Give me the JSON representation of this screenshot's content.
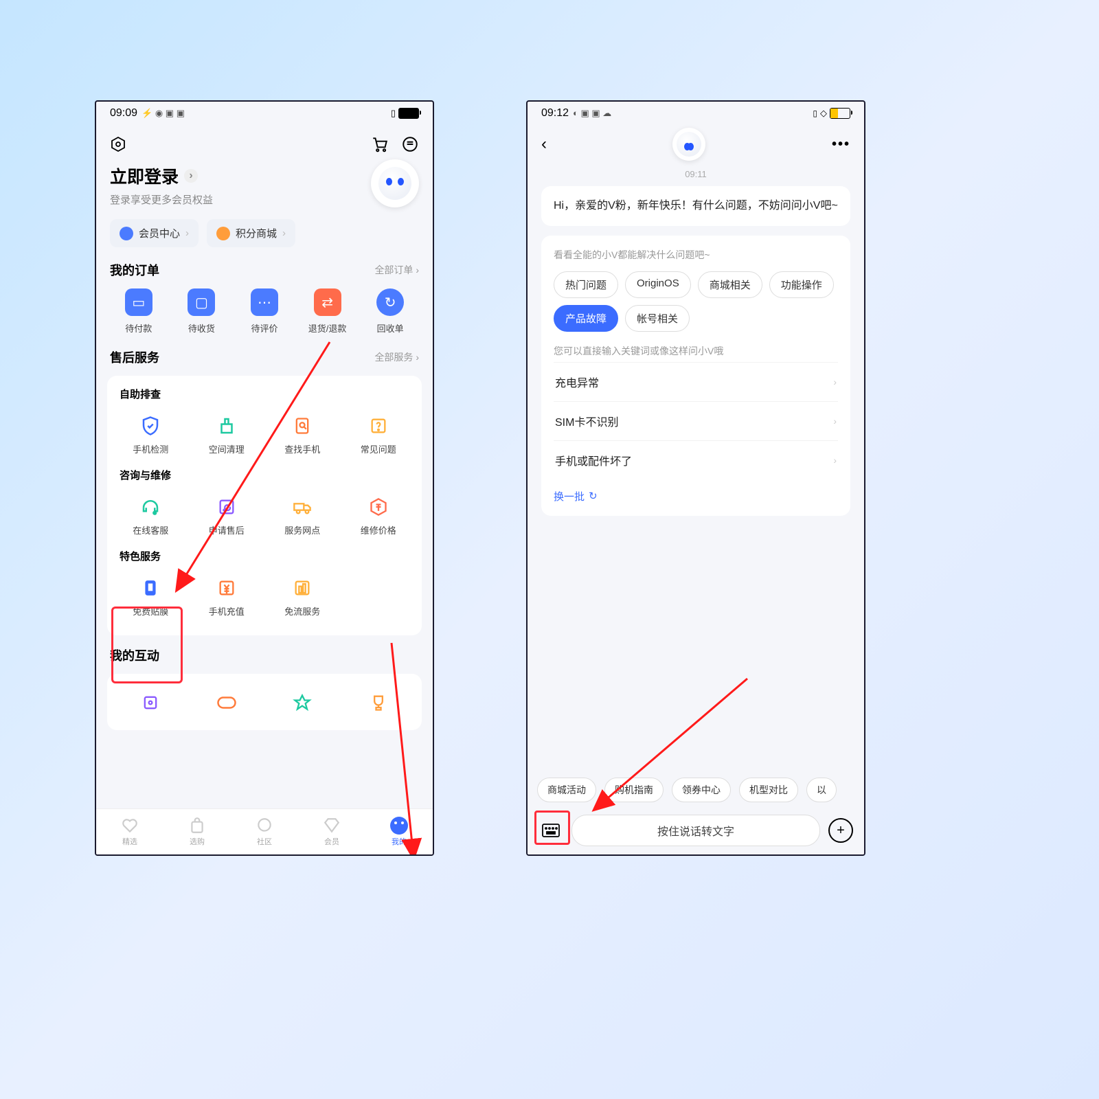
{
  "left": {
    "status_time": "09:09",
    "login_title": "立即登录",
    "login_sub": "登录享受更多会员权益",
    "pills": [
      {
        "label": "会员中心"
      },
      {
        "label": "积分商城"
      }
    ],
    "orders": {
      "title": "我的订单",
      "more": "全部订单",
      "items": [
        "待付款",
        "待收货",
        "待评价",
        "退货/退款",
        "回收单"
      ]
    },
    "service": {
      "title": "售后服务",
      "more": "全部服务",
      "g1_title": "自助排查",
      "g1": [
        "手机检测",
        "空间清理",
        "查找手机",
        "常见问题"
      ],
      "g2_title": "咨询与维修",
      "g2": [
        "在线客服",
        "申请售后",
        "服务网点",
        "维修价格"
      ],
      "g3_title": "特色服务",
      "g3": [
        "免费贴膜",
        "手机充值",
        "免流服务"
      ]
    },
    "interact_title": "我的互动",
    "tabs": [
      "精选",
      "选购",
      "社区",
      "会员",
      "我的"
    ]
  },
  "right": {
    "status_time": "09:12",
    "ts": "09:11",
    "greeting": "Hi，亲爱的V粉，新年快乐！有什么问题，不妨问问小V吧~",
    "q_hint": "看看全能的小V都能解决什么问题吧~",
    "chips": [
      "热门问题",
      "OriginOS",
      "商城相关",
      "功能操作",
      "产品故障",
      "帐号相关"
    ],
    "chip_active": 4,
    "q_hint2": "您可以直接输入关键词或像这样问小V哦",
    "rows": [
      "充电异常",
      "SIM卡不识别",
      "手机或配件坏了"
    ],
    "refresh": "换一批",
    "suggest": [
      "商城活动",
      "购机指南",
      "领券中心",
      "机型对比",
      "以"
    ],
    "voice_input": "按住说话转文字"
  }
}
